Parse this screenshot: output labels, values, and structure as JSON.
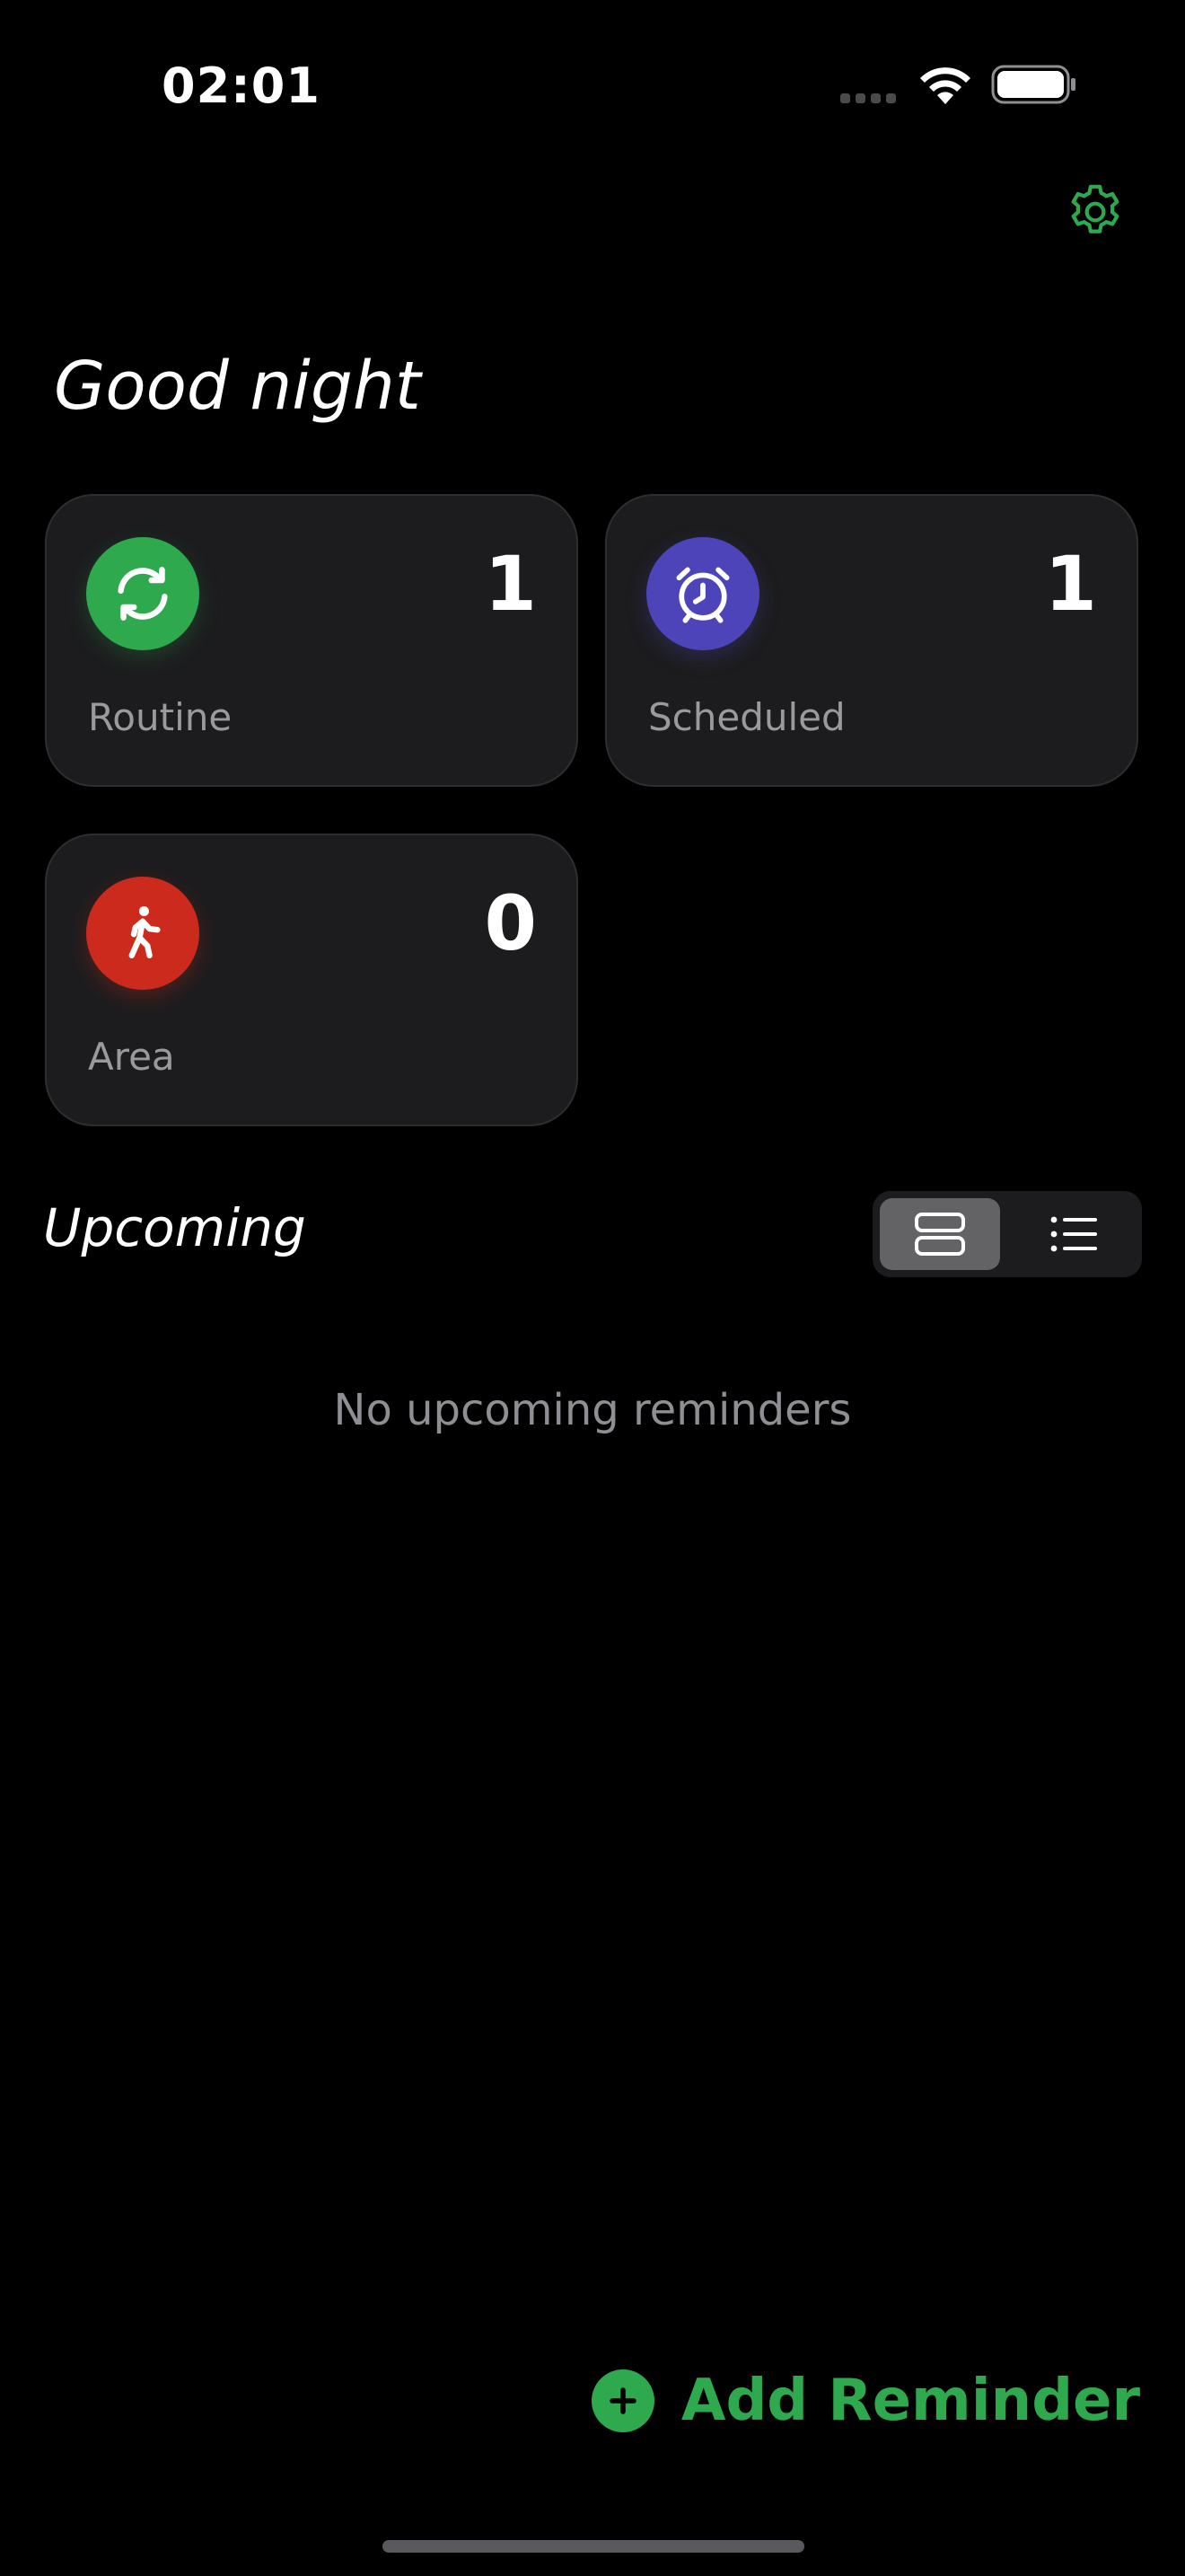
{
  "status_bar": {
    "time": "02:01",
    "signal_icon": "signal-dots-icon",
    "wifi_icon": "wifi-icon",
    "battery_icon": "battery-icon"
  },
  "header": {
    "settings_icon": "gear-icon",
    "greeting": "Good night"
  },
  "colors": {
    "accent": "#2ea94d",
    "routine": "#2ea94d",
    "scheduled": "#4c44b8",
    "area": "#cc2a1c",
    "card_bg": "#1c1c1e"
  },
  "cards": [
    {
      "label": "Routine",
      "count": "1",
      "icon": "refresh-icon"
    },
    {
      "label": "Scheduled",
      "count": "1",
      "icon": "alarm-clock-icon"
    },
    {
      "label": "Area",
      "count": "0",
      "icon": "walking-figure-icon"
    }
  ],
  "upcoming": {
    "title": "Upcoming",
    "view_modes": [
      {
        "icon": "card-view-icon",
        "selected": true
      },
      {
        "icon": "list-view-icon",
        "selected": false
      }
    ],
    "empty_message": "No upcoming reminders"
  },
  "footer": {
    "add_icon": "plus-circle-icon",
    "add_label": "Add Reminder"
  }
}
